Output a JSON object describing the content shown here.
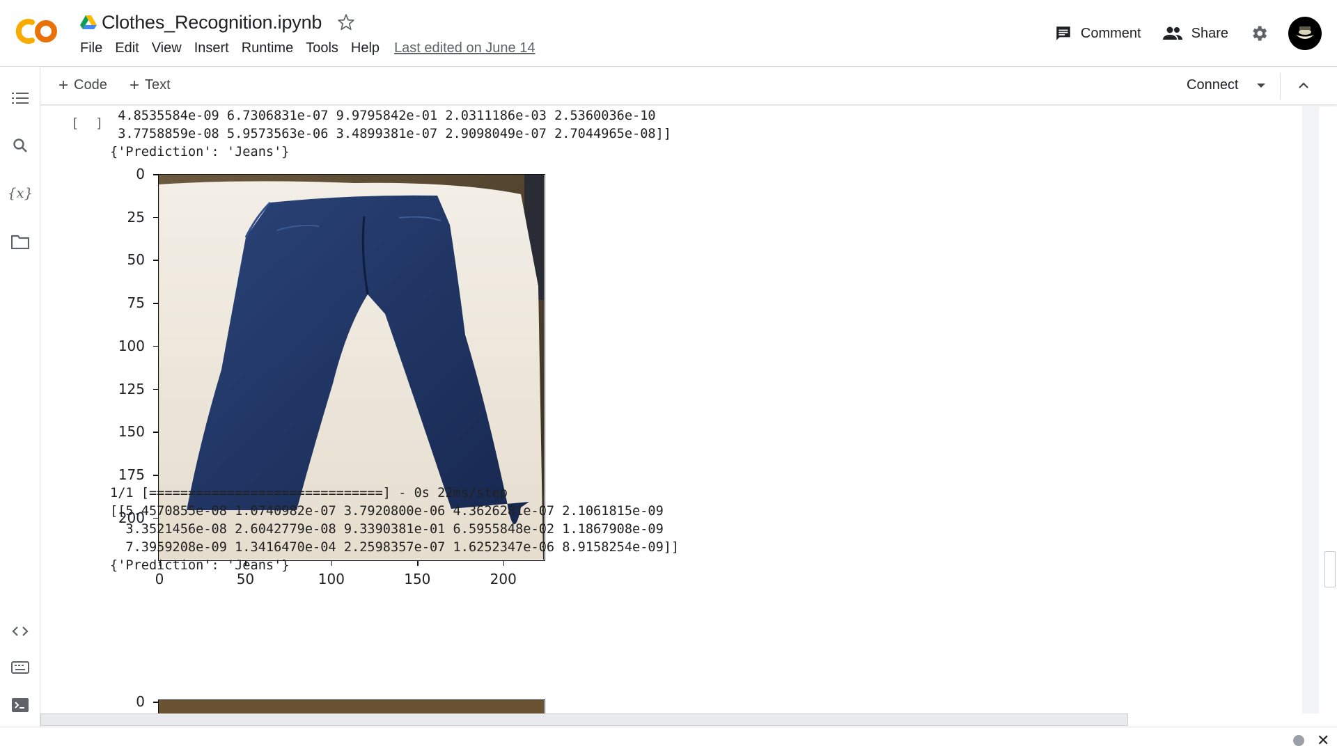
{
  "header": {
    "doc_title": "Clothes_Recognition.ipynb",
    "menu": [
      "File",
      "Edit",
      "View",
      "Insert",
      "Runtime",
      "Tools",
      "Help"
    ],
    "last_edited": "Last edited on June 14",
    "comment_label": "Comment",
    "share_label": "Share"
  },
  "toolbar": {
    "add_code": "Code",
    "add_text": "Text",
    "connect": "Connect"
  },
  "cell": {
    "execution_bracket": "[ ]"
  },
  "output1": {
    "lines": [
      " 4.8535584e-09 6.7306831e-07 9.9795842e-01 2.0311186e-03 2.5360036e-10",
      " 3.7758859e-08 5.9573563e-06 3.4899381e-07 2.9098049e-07 2.7044965e-08]]",
      "{'Prediction': 'Jeans'}"
    ]
  },
  "plot1": {
    "y_ticks": [
      "0",
      "25",
      "50",
      "75",
      "100",
      "125",
      "150",
      "175",
      "200"
    ],
    "x_ticks": [
      "0",
      "50",
      "100",
      "150",
      "200"
    ]
  },
  "output2": {
    "lines": [
      "1/1 [==============================] - 0s 22ms/step",
      "[[5.4570855e-08 1.0740982e-07 3.7920800e-06 4.3626281e-07 2.1061815e-09",
      "  3.3521456e-08 2.6042779e-08 9.3390381e-01 6.5955848e-02 1.1867908e-09",
      "  7.3959208e-09 1.3416470e-04 2.2598357e-07 1.6252347e-06 8.9158254e-09]]",
      "{'Prediction': 'Jeans'}"
    ]
  },
  "plot2": {
    "y_ticks": [
      "0"
    ]
  },
  "colors": {
    "logo_orange": "#f9ab00",
    "logo_orange_dark": "#e8710a",
    "jeans_blue": "#1f3566",
    "sheet_white": "#ede8df"
  }
}
